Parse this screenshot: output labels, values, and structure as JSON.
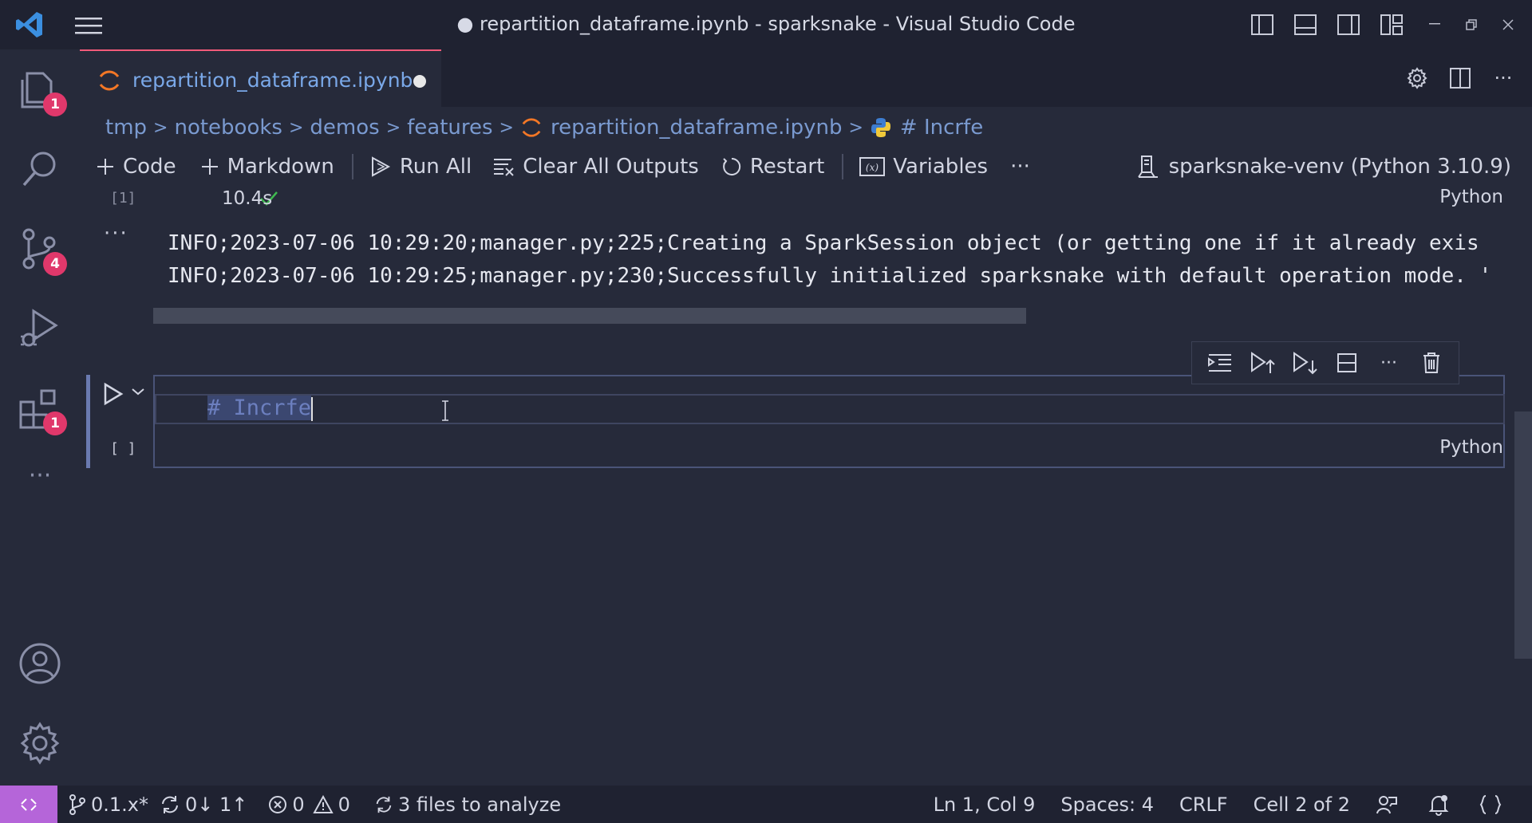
{
  "window": {
    "title": "● repartition_dataframe.ipynb - sparksnake - Visual Studio Code"
  },
  "activity_bar": {
    "explorer_badge": "1",
    "source_control_badge": "4",
    "extensions_badge": "1"
  },
  "tab": {
    "label": "repartition_dataframe.ipynb"
  },
  "breadcrumb": {
    "items": [
      "tmp",
      "notebooks",
      "demos",
      "features",
      "repartition_dataframe.ipynb",
      "# Incrfe"
    ]
  },
  "toolbar": {
    "code": "Code",
    "markdown": "Markdown",
    "run_all": "Run All",
    "clear_outputs": "Clear All Outputs",
    "restart": "Restart",
    "variables": "Variables",
    "more": "···",
    "kernel": "sparksnake-venv (Python 3.10.9)"
  },
  "cell1": {
    "exec_count": "[1]",
    "duration": "10.4s",
    "language": "Python",
    "output_more": "···",
    "output_lines": [
      "INFO;2023-07-06 10:29:20;manager.py;225;Creating a SparkSession object (or getting one if it already exis",
      "INFO;2023-07-06 10:29:25;manager.py;230;Successfully initialized sparksnake with default operation mode. '"
    ]
  },
  "cell2": {
    "exec_count": "[ ]",
    "code": "# Incrfe",
    "language": "Python"
  },
  "statusbar": {
    "branch": "0.1.x*",
    "sync": "0↓ 1↑",
    "errors": "0",
    "warnings": "0",
    "analyze": "3 files to analyze",
    "position": "Ln 1, Col 9",
    "spaces": "Spaces: 4",
    "eol": "CRLF",
    "cell": "Cell 2 of 2"
  },
  "colors": {
    "accent": "#b565d9",
    "badge": "#e0386b",
    "tab_border": "#f25a7a",
    "success": "#3fb950"
  }
}
